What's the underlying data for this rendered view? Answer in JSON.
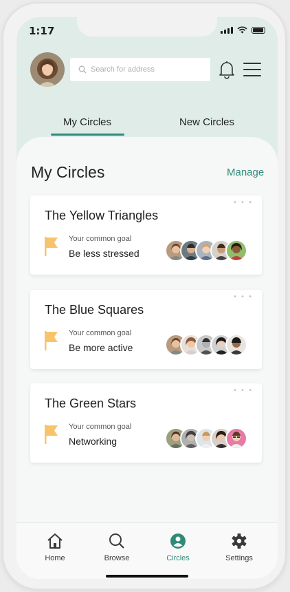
{
  "status_bar": {
    "time": "1:17"
  },
  "header": {
    "search_placeholder": "Search for address"
  },
  "tabs": [
    {
      "label": "My Circles",
      "active": true
    },
    {
      "label": "New Circles",
      "active": false
    }
  ],
  "main": {
    "heading": "My Circles",
    "manage_label": "Manage",
    "cards": [
      {
        "title": "The Yellow Triangles",
        "goal_caption": "Your common goal",
        "goal": "Be less stressed"
      },
      {
        "title": "The Blue Squares",
        "goal_caption": "Your common goal",
        "goal": "Be more active"
      },
      {
        "title": "The Green Stars",
        "goal_caption": "Your common goal",
        "goal": "Networking"
      }
    ]
  },
  "bottom_nav": [
    {
      "label": "Home",
      "icon": "home-icon"
    },
    {
      "label": "Browse",
      "icon": "search-icon"
    },
    {
      "label": "Circles",
      "icon": "circles-icon",
      "active": true
    },
    {
      "label": "Settings",
      "icon": "gear-icon"
    }
  ],
  "colors": {
    "accent": "#2f8a78",
    "header_bg": "#dfece8",
    "flag": "#f7c46b"
  }
}
